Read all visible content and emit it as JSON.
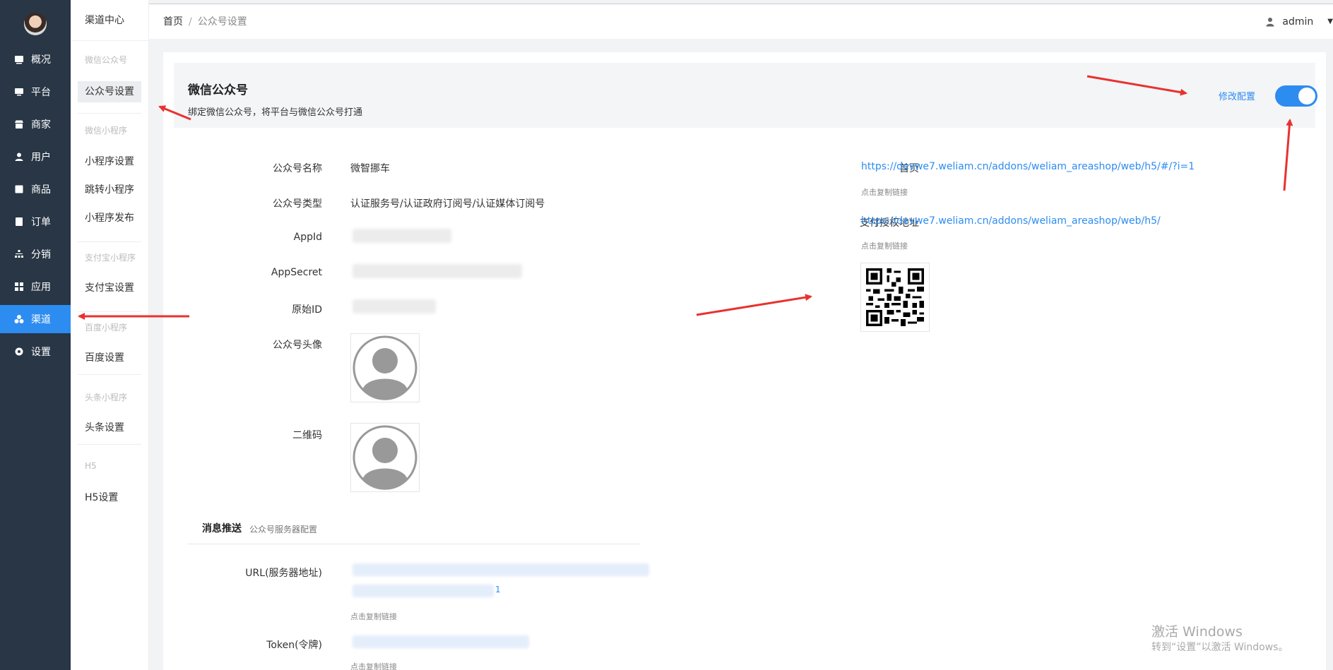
{
  "sidebar": {
    "items": [
      {
        "label": "概况",
        "icon": "dashboard-icon"
      },
      {
        "label": "平台",
        "icon": "monitor-icon"
      },
      {
        "label": "商家",
        "icon": "store-icon"
      },
      {
        "label": "用户",
        "icon": "user-icon"
      },
      {
        "label": "商品",
        "icon": "goods-icon"
      },
      {
        "label": "订单",
        "icon": "order-icon"
      },
      {
        "label": "分销",
        "icon": "distribution-icon"
      },
      {
        "label": "应用",
        "icon": "apps-icon"
      },
      {
        "label": "渠道",
        "icon": "channel-icon"
      },
      {
        "label": "设置",
        "icon": "gear-icon"
      }
    ],
    "active_index": 8
  },
  "submenu": {
    "title": "渠道中心",
    "groups": [
      {
        "title": "微信公众号",
        "items": [
          "公众号设置"
        ]
      },
      {
        "title": "微信小程序",
        "items": [
          "小程序设置",
          "跳转小程序",
          "小程序发布"
        ]
      },
      {
        "title": "支付宝小程序",
        "items": [
          "支付宝设置"
        ]
      },
      {
        "title": "百度小程序",
        "items": [
          "百度设置"
        ]
      },
      {
        "title": "头条小程序",
        "items": [
          "头条设置"
        ]
      },
      {
        "title": "H5",
        "items": [
          "H5设置"
        ]
      }
    ],
    "active_item": "公众号设置"
  },
  "topbar": {
    "breadcrumb_home": "首页",
    "breadcrumb_sep": "/",
    "breadcrumb_current": "公众号设置",
    "user": "admin"
  },
  "banner": {
    "title": "微信公众号",
    "desc": "绑定微信公众号，将平台与微信公众号打通",
    "edit_label": "修改配置",
    "enabled": true
  },
  "left_fields": {
    "name_label": "公众号名称",
    "name_value": "微智挪车",
    "type_label": "公众号类型",
    "type_value": "认证服务号/认证政府订阅号/认证媒体订阅号",
    "appid_label": "AppId",
    "secret_label": "AppSecret",
    "origin_label": "原始ID",
    "avatar_label": "公众号头像",
    "qrcode_label": "二维码"
  },
  "right_fields": {
    "home_label": "首页",
    "home_url": "https://devwe7.weliam.cn/addons/weliam_areashop/web/h5/#/?i=1",
    "home_hint": "点击复制链接",
    "pay_label": "支付授权地址",
    "pay_url": "https://devwe7.weliam.cn/addons/weliam_areashop/web/h5/",
    "pay_hint": "点击复制链接",
    "qr_label": "首页二维码"
  },
  "message_push": {
    "title": "消息推送",
    "subtitle": "公众号服务器配置",
    "url_label": "URL(服务器地址)",
    "url_tail": "1",
    "url_hint": "点击复制链接",
    "token_label": "Token(令牌)",
    "token_hint": "点击复制链接"
  },
  "watermark": {
    "line1": "激活 Windows",
    "line2": "转到“设置”以激活 Windows。"
  },
  "colors": {
    "sidebar_bg": "#283645",
    "accent": "#2d8cf0",
    "annotation_arrow": "#e8322f"
  }
}
